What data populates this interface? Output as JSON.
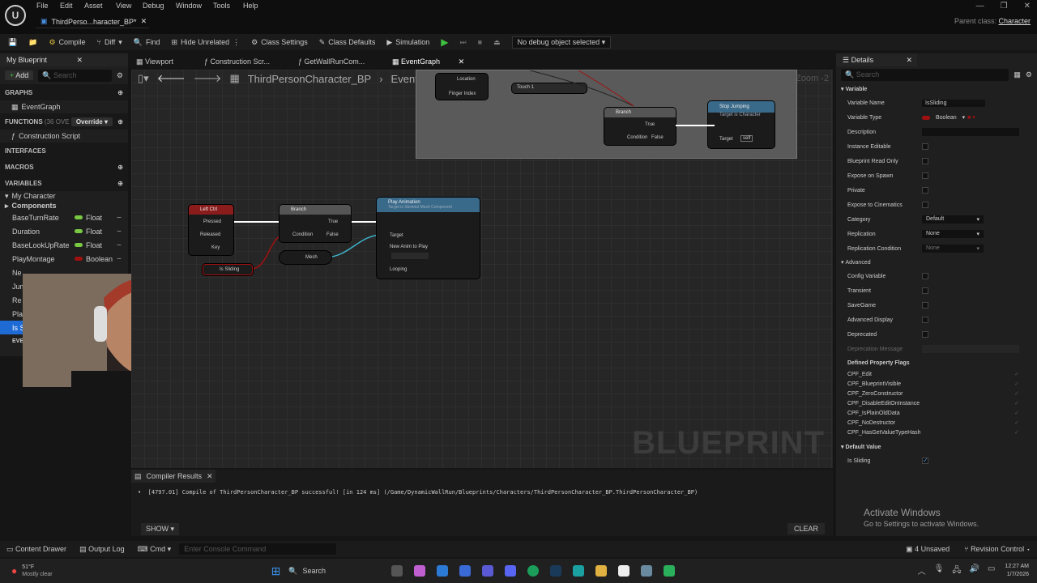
{
  "menu": [
    "File",
    "Edit",
    "Asset",
    "View",
    "Debug",
    "Window",
    "Tools",
    "Help"
  ],
  "doc_tab": "ThirdPerso...haracter_BP*",
  "parent_class_label": "Parent class:",
  "parent_class_value": "Character",
  "toolbar": {
    "compile": "Compile",
    "diff": "Diff",
    "find": "Find",
    "hide_unrelated": "Hide Unrelated",
    "class_settings": "Class Settings",
    "class_defaults": "Class Defaults",
    "simulation": "Simulation",
    "debug_select": "No debug object selected"
  },
  "my_blueprint": {
    "tab": "My Blueprint",
    "add": "Add",
    "search_placeholder": "Search",
    "graphs": "GRAPHS",
    "event_graph": "EventGraph",
    "functions": "FUNCTIONS",
    "functions_hint": "(36 OVE",
    "override": "Override",
    "construction_script": "Construction Script",
    "interfaces": "INTERFACES",
    "macros": "MACROS",
    "variables": "VARIABLES",
    "category": "My Character",
    "components": "Components",
    "vars": [
      {
        "name": "BaseTurnRate",
        "type": "Float"
      },
      {
        "name": "Duration",
        "type": "Float"
      },
      {
        "name": "BaseLookUpRate",
        "type": "Float"
      },
      {
        "name": "PlayMontage",
        "type": "Boolean"
      }
    ],
    "partial_rows": [
      "Ne",
      "Jum",
      "Re",
      "Pla",
      "Is S",
      "EVE"
    ]
  },
  "graph_tabs": [
    "Viewport",
    "Construction Scr...",
    "GetWallRunCom...",
    "EventGraph"
  ],
  "breadcrumb": {
    "bp": "ThirdPersonCharacter_BP",
    "graph": "EventGraph",
    "zoom": "Zoom -2"
  },
  "nodes": {
    "left_ctrl": {
      "title": "Left Ctrl",
      "pins": [
        "Pressed",
        "Released",
        "Key"
      ]
    },
    "is_sliding": "Is Sliding",
    "branch": {
      "title": "Branch",
      "pins": [
        "Condition",
        "True",
        "False"
      ]
    },
    "mesh": "Mesh",
    "play_anim": {
      "title": "Play Animation",
      "subtitle": "Target is Skeletal Mesh Component",
      "pins": [
        "Target",
        "New Anim to Play",
        "Looping"
      ]
    },
    "upper": {
      "location": "Location",
      "finger_index": "Finger Index",
      "touch": "Touch 1",
      "branch": "Branch",
      "condition": "Condition",
      "true": "True",
      "false": "False",
      "stop_jumping": "Stop Jumping",
      "stop_sub": "Target is Character",
      "target": "Target",
      "self": "self"
    }
  },
  "watermark": "BLUEPRINT",
  "compiler": {
    "tab": "Compiler Results",
    "message": "[4797.01] Compile of ThirdPersonCharacter_BP successful! [in 124 ms] (/Game/DynamicWallRun/Blueprints/Characters/ThirdPersonCharacter_BP.ThirdPersonCharacter_BP)",
    "show": "SHOW",
    "clear": "CLEAR"
  },
  "details": {
    "tab": "Details",
    "search_placeholder": "Search",
    "variable": "Variable",
    "rows": [
      [
        "Variable Name",
        "IsSliding"
      ],
      [
        "Variable Type",
        "Boolean"
      ],
      [
        "Description",
        ""
      ],
      [
        "Instance Editable",
        ""
      ],
      [
        "Blueprint Read Only",
        ""
      ],
      [
        "Expose on Spawn",
        ""
      ],
      [
        "Private",
        ""
      ],
      [
        "Expose to Cinematics",
        ""
      ],
      [
        "Category",
        "Default"
      ],
      [
        "Replication",
        "None"
      ],
      [
        "Replication Condition",
        "None"
      ]
    ],
    "advanced": "Advanced",
    "adv_rows": [
      "Config Variable",
      "Transient",
      "SaveGame",
      "Advanced Display",
      "Deprecated",
      "Deprecation Message"
    ],
    "flags_title": "Defined Property Flags",
    "flags": [
      "CPF_Edit",
      "CPF_BlueprintVisible",
      "CPF_ZeroConstructor",
      "CPF_DisableEditOnInstance",
      "CPF_IsPlainOldData",
      "CPF_NoDestructor",
      "CPF_HasGetValueTypeHash"
    ],
    "default_value": "Default Value",
    "is_sliding_label": "Is Sliding"
  },
  "activate": {
    "title": "Activate Windows",
    "sub": "Go to Settings to activate Windows."
  },
  "status": {
    "content_drawer": "Content Drawer",
    "output_log": "Output Log",
    "cmd": "Cmd",
    "console_placeholder": "Enter Console Command",
    "unsaved": "4 Unsaved",
    "revision": "Revision Control"
  },
  "taskbar": {
    "temp": "51°F",
    "weather": "Mostly clear",
    "search": "Search",
    "time": "12:27 AM",
    "date": "1/7/2026"
  },
  "colors": {
    "float": "#7ac943",
    "bool": "#a01010",
    "accent": "#1e6bd6",
    "exec": "#ffffff"
  }
}
